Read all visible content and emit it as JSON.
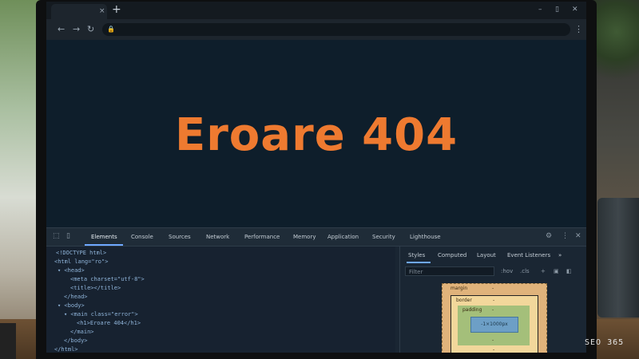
{
  "browser": {
    "new_tab_icon": "plus-icon",
    "close_tab_glyph": "×",
    "new_tab_glyph": "+",
    "minimize_glyph": "–",
    "maximize_glyph": "▯",
    "close_glyph": "✕",
    "back_glyph": "←",
    "forward_glyph": "→",
    "reload_glyph": "↻",
    "lock_glyph": "🔒",
    "menu_glyph": "⋮"
  },
  "page": {
    "heading": "Eroare 404",
    "heading_color": "#ee7a30",
    "background_color": "#0e1e2b"
  },
  "devtools": {
    "tabs": [
      "Elements",
      "Console",
      "Sources",
      "Network",
      "Performance",
      "Memory",
      "Application",
      "Security",
      "Lighthouse"
    ],
    "active_tab": "Elements",
    "settings_glyph": "⚙",
    "menu_glyph": "⋮",
    "close_glyph": "✕",
    "inspect_glyph": "⬚",
    "device_glyph": "▯",
    "dom_lines": [
      "<!DOCTYPE html>",
      "<html lang=\"ro\">",
      "▾ <head>",
      "<meta charset=\"utf-8\">",
      "<title></title>",
      "</head>",
      "▾ <body>",
      "▾ <main class=\"error\">",
      "<h1>Eroare 404</h1>",
      "</main>",
      "</body>",
      "</html>"
    ],
    "styles": {
      "tabs": [
        "Styles",
        "Computed",
        "Layout",
        "Event Listeners",
        "»"
      ],
      "filter_placeholder": "Filter",
      "hov": ":hov",
      "cls": ".cls",
      "plus": "+",
      "box_model": {
        "margin_label": "margin",
        "border_label": "border",
        "padding_label": "padding",
        "dash": "-",
        "content": "-1×1000px"
      }
    }
  },
  "watermark": "SEO 365"
}
